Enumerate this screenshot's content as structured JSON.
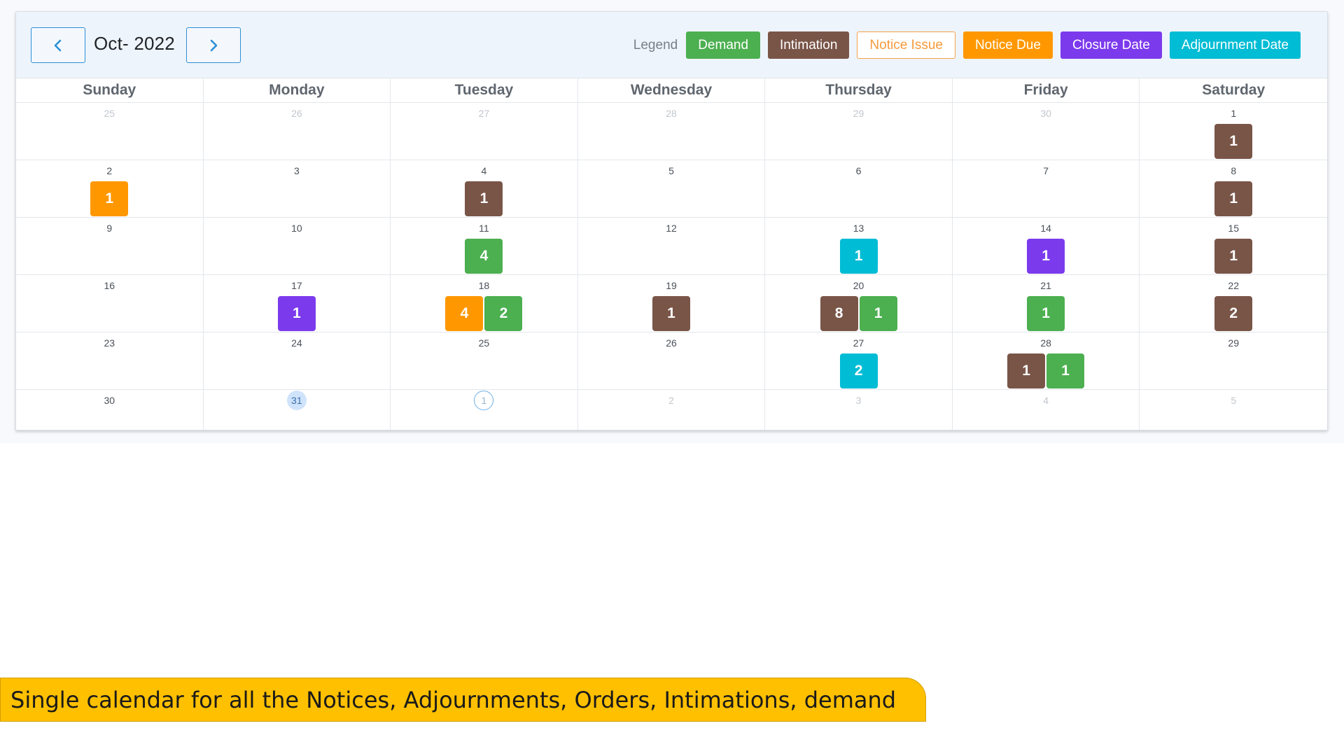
{
  "header": {
    "month_title": "Oct- 2022",
    "prev_icon": "chevron-left-icon",
    "next_icon": "chevron-right-icon"
  },
  "legend": {
    "label": "Legend",
    "items": [
      {
        "key": "demand",
        "label": "Demand",
        "color": "#4caf50",
        "style": "filled"
      },
      {
        "key": "intimation",
        "label": "Intimation",
        "color": "#795548",
        "style": "filled"
      },
      {
        "key": "notice_issue",
        "label": "Notice Issue",
        "color": "#f5a24a",
        "style": "outline"
      },
      {
        "key": "notice_due",
        "label": "Notice Due",
        "color": "#ff9800",
        "style": "filled"
      },
      {
        "key": "closure_date",
        "label": "Closure Date",
        "color": "#7c3aed",
        "style": "filled"
      },
      {
        "key": "adjournment_date",
        "label": "Adjournment Date",
        "color": "#00bcd4",
        "style": "filled"
      }
    ]
  },
  "weekdays": [
    "Sunday",
    "Monday",
    "Tuesday",
    "Wednesday",
    "Thursday",
    "Friday",
    "Saturday"
  ],
  "weeks": [
    [
      {
        "day": "25",
        "other": true,
        "events": []
      },
      {
        "day": "26",
        "other": true,
        "events": []
      },
      {
        "day": "27",
        "other": true,
        "events": []
      },
      {
        "day": "28",
        "other": true,
        "events": []
      },
      {
        "day": "29",
        "other": true,
        "events": []
      },
      {
        "day": "30",
        "other": true,
        "events": []
      },
      {
        "day": "1",
        "events": [
          {
            "type": "intimation",
            "count": "1"
          }
        ]
      }
    ],
    [
      {
        "day": "2",
        "events": [
          {
            "type": "notice_due",
            "count": "1"
          }
        ]
      },
      {
        "day": "3",
        "events": []
      },
      {
        "day": "4",
        "events": [
          {
            "type": "intimation",
            "count": "1"
          }
        ]
      },
      {
        "day": "5",
        "events": []
      },
      {
        "day": "6",
        "events": []
      },
      {
        "day": "7",
        "events": []
      },
      {
        "day": "8",
        "events": [
          {
            "type": "intimation",
            "count": "1"
          }
        ]
      }
    ],
    [
      {
        "day": "9",
        "events": []
      },
      {
        "day": "10",
        "events": []
      },
      {
        "day": "11",
        "events": [
          {
            "type": "demand",
            "count": "4"
          }
        ]
      },
      {
        "day": "12",
        "events": []
      },
      {
        "day": "13",
        "events": [
          {
            "type": "adjournment_date",
            "count": "1"
          }
        ]
      },
      {
        "day": "14",
        "events": [
          {
            "type": "closure_date",
            "count": "1"
          }
        ]
      },
      {
        "day": "15",
        "events": [
          {
            "type": "intimation",
            "count": "1"
          }
        ]
      }
    ],
    [
      {
        "day": "16",
        "events": []
      },
      {
        "day": "17",
        "events": [
          {
            "type": "closure_date",
            "count": "1"
          }
        ]
      },
      {
        "day": "18",
        "events": [
          {
            "type": "notice_due",
            "count": "4"
          },
          {
            "type": "demand",
            "count": "2"
          }
        ]
      },
      {
        "day": "19",
        "events": [
          {
            "type": "intimation",
            "count": "1"
          }
        ]
      },
      {
        "day": "20",
        "events": [
          {
            "type": "intimation",
            "count": "8"
          },
          {
            "type": "demand",
            "count": "1"
          }
        ]
      },
      {
        "day": "21",
        "events": [
          {
            "type": "demand",
            "count": "1"
          }
        ]
      },
      {
        "day": "22",
        "events": [
          {
            "type": "intimation",
            "count": "2"
          }
        ]
      }
    ],
    [
      {
        "day": "23",
        "events": []
      },
      {
        "day": "24",
        "events": []
      },
      {
        "day": "25",
        "events": []
      },
      {
        "day": "26",
        "events": []
      },
      {
        "day": "27",
        "events": [
          {
            "type": "adjournment_date",
            "count": "2"
          }
        ]
      },
      {
        "day": "28",
        "events": [
          {
            "type": "intimation",
            "count": "1"
          },
          {
            "type": "demand",
            "count": "1"
          }
        ]
      },
      {
        "day": "29",
        "events": []
      }
    ],
    [
      {
        "day": "30",
        "events": []
      },
      {
        "day": "31",
        "today": true,
        "events": []
      },
      {
        "day": "1",
        "other": true,
        "selected": true,
        "events": []
      },
      {
        "day": "2",
        "other": true,
        "events": []
      },
      {
        "day": "3",
        "other": true,
        "events": []
      },
      {
        "day": "4",
        "other": true,
        "events": []
      },
      {
        "day": "5",
        "other": true,
        "events": []
      }
    ]
  ],
  "banner": {
    "text": "Single calendar for all the Notices, Adjournments, Orders, Intimations, demand",
    "color": "#ffc000"
  }
}
